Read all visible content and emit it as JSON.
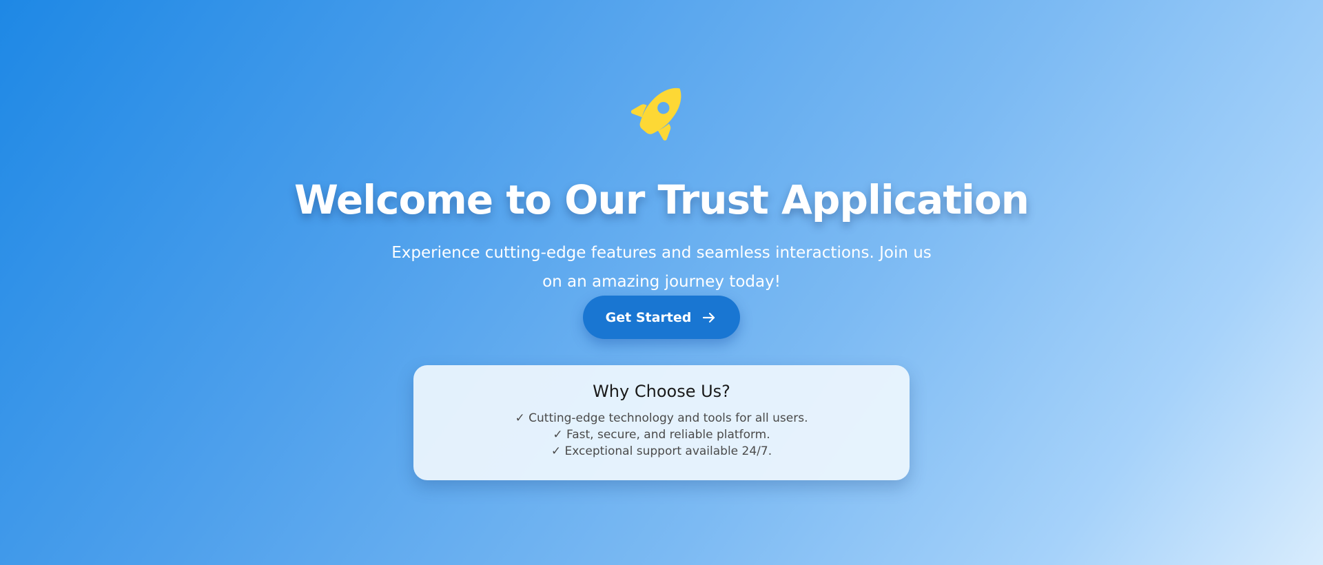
{
  "hero": {
    "icon": "rocket-icon",
    "icon_color": "#fdd835",
    "title": "Welcome to Our Trust Application",
    "subtitle": "Experience cutting-edge features and seamless interactions. Join us on an amazing journey today!",
    "cta": {
      "label": "Get Started",
      "icon": "arrow-right-icon",
      "color": "#1976d2"
    }
  },
  "features": {
    "title": "Why Choose Us?",
    "items": [
      "✓ Cutting-edge technology and tools for all users.",
      "✓ Fast, secure, and reliable platform.",
      "✓ Exceptional support available 24/7."
    ]
  },
  "colors": {
    "gradient_start": "#1e88e5",
    "gradient_end": "#d8ecfd",
    "card_bg": "#ecf5fd"
  }
}
